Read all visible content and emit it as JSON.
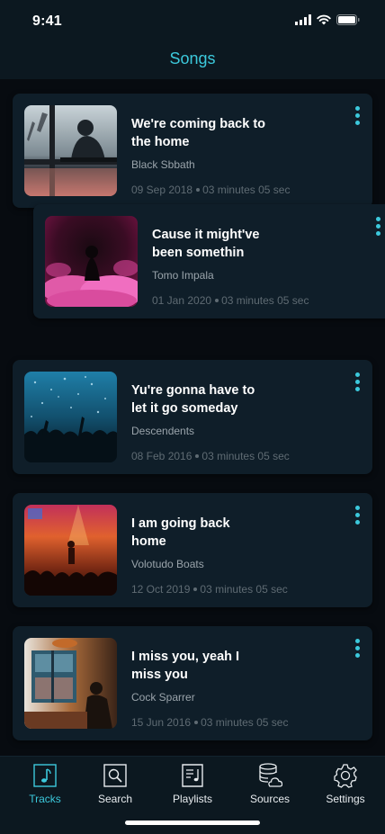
{
  "status_bar": {
    "time": "9:41"
  },
  "header": {
    "title": "Songs"
  },
  "songs": [
    {
      "title": "We're coming back to the home",
      "artist": "Black Sbbath",
      "date": "09 Sep 2018",
      "duration": "03 minutes 05 sec"
    },
    {
      "title": "Cause it might've been somethin",
      "artist": "Tomo Impala",
      "date": "01 Jan 2020",
      "duration": "03 minutes 05 sec"
    },
    {
      "title": "Yu're gonna have to let it go someday",
      "artist": "Descendents",
      "date": "08 Feb 2016",
      "duration": "03 minutes 05 sec"
    },
    {
      "title": "I am going back home",
      "artist": "Volotudo Boats",
      "date": "12 Oct 2019",
      "duration": "03 minutes 05 sec"
    },
    {
      "title": "I miss you, yeah I miss you",
      "artist": "Cock Sparrer",
      "date": "15 Jun 2016",
      "duration": "03 minutes 05 sec"
    }
  ],
  "tabs": [
    {
      "label": "Tracks",
      "icon": "music-note-icon",
      "active": true
    },
    {
      "label": "Search",
      "icon": "search-icon",
      "active": false
    },
    {
      "label": "Playlists",
      "icon": "playlist-icon",
      "active": false
    },
    {
      "label": "Sources",
      "icon": "database-cloud-icon",
      "active": false
    },
    {
      "label": "Settings",
      "icon": "gear-icon",
      "active": false
    }
  ],
  "colors": {
    "accent": "#3cc9dc",
    "background": "#070b10",
    "card": "#0f1e29",
    "bar": "#0c1820"
  }
}
